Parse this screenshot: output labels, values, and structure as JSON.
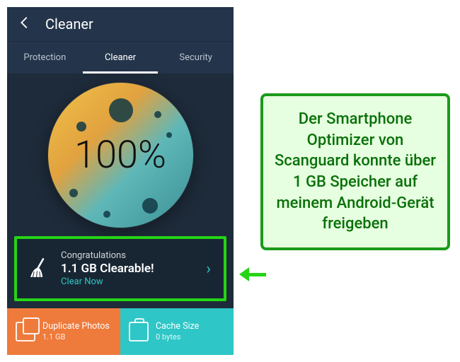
{
  "header": {
    "title": "Cleaner"
  },
  "tabs": {
    "items": [
      "Protection",
      "Cleaner",
      "Security"
    ],
    "active_index": 1
  },
  "hero": {
    "percent_label": "100%"
  },
  "scan_card": {
    "line1": "Congratulations",
    "line2": "1.1 GB Clearable!",
    "action": "Clear Now"
  },
  "tiles": {
    "duplicate": {
      "title": "Duplicate Photos",
      "subtitle": "1.1 GB"
    },
    "cache": {
      "title": "Cache Size",
      "subtitle": "0 bytes"
    }
  },
  "callout": {
    "text": "Der Smartphone Optimizer von Scanguard konnte über 1 GB Speicher auf meinem Android-Gerät freigeben"
  },
  "colors": {
    "highlight_border": "#25d416",
    "tile_orange": "#ee7a3b",
    "tile_teal": "#2ec6c6",
    "bg_dark": "#1e2b3a"
  }
}
